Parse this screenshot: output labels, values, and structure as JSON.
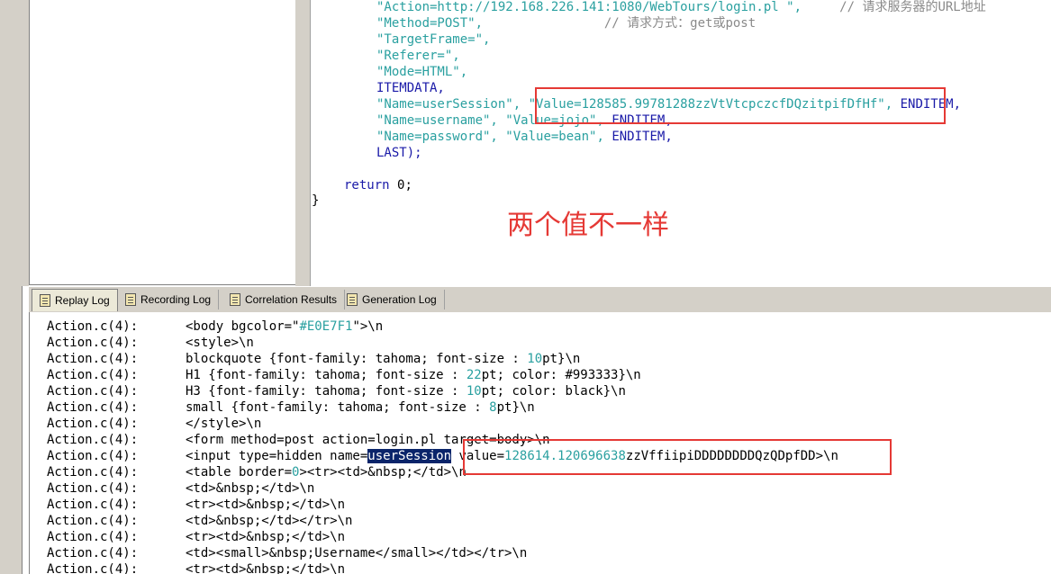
{
  "code_editor": {
    "lines": [
      [
        {
          "t": "\"Action=http://192.168.226.141:1080/WebTours/login.pl \",",
          "c": "str"
        },
        {
          "t": "     // 请求服务器的URL地址",
          "c": "cm"
        }
      ],
      [
        {
          "t": "\"Method=POST\",",
          "c": "str"
        },
        {
          "t": "                // 请求方式：get或post",
          "c": "cm"
        }
      ],
      [
        {
          "t": "\"TargetFrame=\",",
          "c": "str"
        }
      ],
      [
        {
          "t": "\"Referer=\",",
          "c": "str"
        }
      ],
      [
        {
          "t": "\"Mode=HTML\",",
          "c": "str"
        }
      ],
      [
        {
          "t": "ITEMDATA,",
          "c": "kw"
        }
      ],
      [
        {
          "t": "\"Name=userSession\", ",
          "c": "str"
        },
        {
          "t": "\"Value=128585.99781288zzVtVtcpczcfDQzitpifDfHf\", ",
          "c": "str"
        },
        {
          "t": "ENDITEM,",
          "c": "kw"
        }
      ],
      [
        {
          "t": "\"Name=username\", ",
          "c": "str"
        },
        {
          "t": "\"Value=jojo\", ",
          "c": "str"
        },
        {
          "t": "ENDITEM,",
          "c": "kw"
        }
      ],
      [
        {
          "t": "\"Name=password\", ",
          "c": "str"
        },
        {
          "t": "\"Value=bean\", ",
          "c": "str"
        },
        {
          "t": "ENDITEM,",
          "c": "kw"
        }
      ],
      [
        {
          "t": "LAST);",
          "c": "kw"
        }
      ]
    ],
    "return_line": [
      {
        "t": "return ",
        "c": "kw"
      },
      {
        "t": "0;",
        "c": "plain"
      }
    ],
    "closing_brace": "}"
  },
  "annotation": "两个值不一样",
  "tabs": [
    {
      "label": "Replay Log",
      "active": true
    },
    {
      "label": "Recording Log",
      "active": false
    },
    {
      "label": "Correlation Results",
      "active": false
    },
    {
      "label": "Generation Log",
      "active": false
    }
  ],
  "replay_log": {
    "prefix": "Action.c(4):",
    "lines": [
      [
        {
          "t": "<body bgcolor=\""
        },
        {
          "t": "#E0E7F1",
          "c": "num"
        },
        {
          "t": "\">\\n"
        }
      ],
      [
        {
          "t": "<style>\\n"
        }
      ],
      [
        {
          "t": "blockquote {font-family: tahoma; font-size : "
        },
        {
          "t": "10",
          "c": "num"
        },
        {
          "t": "pt}\\n"
        }
      ],
      [
        {
          "t": "H1 {font-family: tahoma; font-size : "
        },
        {
          "t": "22",
          "c": "num"
        },
        {
          "t": "pt; color: #993333}\\n"
        }
      ],
      [
        {
          "t": "H3 {font-family: tahoma; font-size : "
        },
        {
          "t": "10",
          "c": "num"
        },
        {
          "t": "pt; color: black}\\n"
        }
      ],
      [
        {
          "t": "small {font-family: tahoma; font-size : "
        },
        {
          "t": "8",
          "c": "num"
        },
        {
          "t": "pt}\\n"
        }
      ],
      [
        {
          "t": "</style>\\n"
        }
      ],
      [
        {
          "t": "<form method=post action=login.pl target=body>\\n"
        }
      ],
      [
        {
          "t": "<input type=hidden name="
        },
        {
          "t": "userSession",
          "c": "sel"
        },
        {
          "t": " value="
        },
        {
          "t": "128614.120696638",
          "c": "num"
        },
        {
          "t": "zzVffiipiDDDDDDDDQzQDpfDD>\\n"
        }
      ],
      [
        {
          "t": "<table border="
        },
        {
          "t": "0",
          "c": "num"
        },
        {
          "t": "><tr><td>&nbsp;</td>\\n"
        }
      ],
      [
        {
          "t": "<td>&nbsp;</td>\\n"
        }
      ],
      [
        {
          "t": "<tr><td>&nbsp;</td>\\n"
        }
      ],
      [
        {
          "t": "<td>&nbsp;</td></tr>\\n"
        }
      ],
      [
        {
          "t": "<tr><td>&nbsp;</td>\\n"
        }
      ],
      [
        {
          "t": "<td><small>&nbsp;Username</small></td></tr>\\n"
        }
      ],
      [
        {
          "t": "<tr><td>&nbsp;</td>\\n"
        }
      ]
    ]
  },
  "colors": {
    "highlight_box": "#e53935",
    "string": "#2aa0a0",
    "keyword": "#1a1aa8",
    "comment": "#8a8a8a",
    "selection": "#0a246a"
  }
}
